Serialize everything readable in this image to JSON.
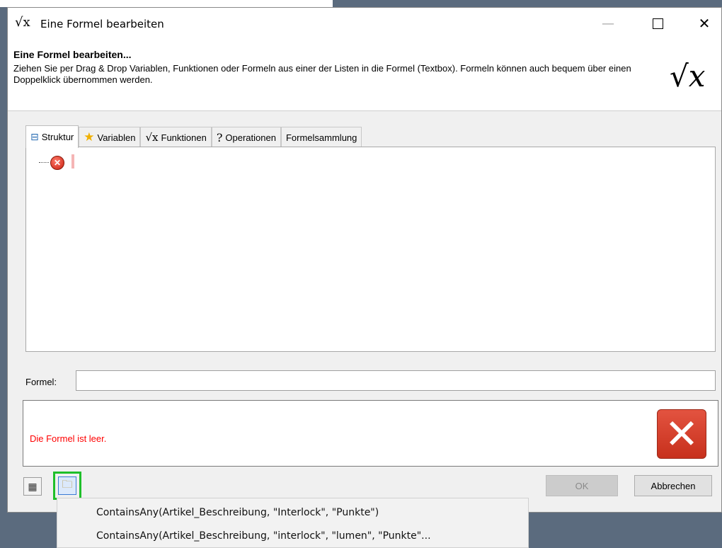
{
  "window": {
    "title": "Eine Formel bearbeiten",
    "title_icon": "√x"
  },
  "header": {
    "title": "Eine Formel bearbeiten...",
    "description": "Ziehen Sie per Drag & Drop Variablen, Funktionen oder Formeln aus einer der Listen in die Formel (Textbox). Formeln können auch bequem über einen Doppelklick übernommen werden.",
    "logo": "√x"
  },
  "tabs": [
    {
      "label": "Struktur",
      "icon": "structure-icon"
    },
    {
      "label": "Variablen",
      "icon": "star-icon"
    },
    {
      "label": "Funktionen",
      "icon": "sqrt-icon"
    },
    {
      "label": "Operationen",
      "icon": "question-icon"
    },
    {
      "label": "Formelsammlung",
      "icon": ""
    }
  ],
  "formula": {
    "label": "Formel:",
    "value": ""
  },
  "message": {
    "text": "Die Formel ist leer.",
    "color": "#ff0000"
  },
  "buttons": {
    "ok": "OK",
    "cancel": "Abbrechen"
  },
  "dropdown": {
    "items": [
      "ContainsAny(Artikel_Beschreibung, \"Interlock\", \"Punkte\")",
      "ContainsAny(Artikel_Beschreibung, \"interlock\", \"lumen\", \"Punkte\"..."
    ]
  },
  "colors": {
    "highlight_border": "#1fbf2a",
    "error_red": "#d43a25"
  }
}
